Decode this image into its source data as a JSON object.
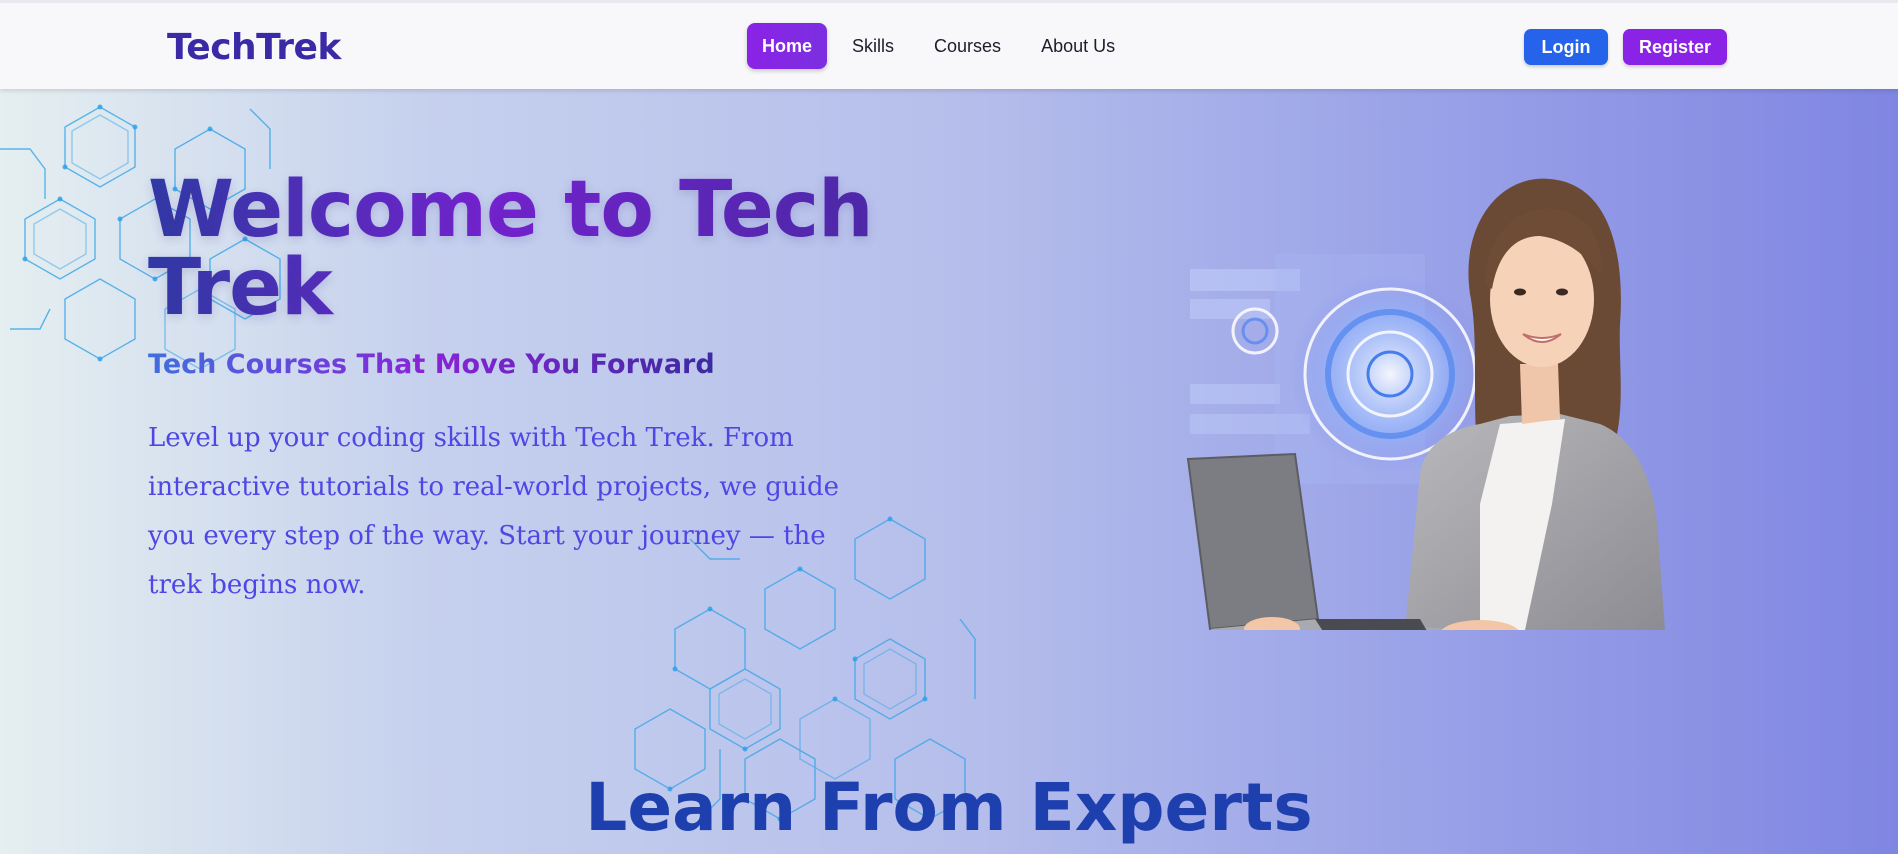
{
  "nav": {
    "logo": "TechTrek",
    "links": [
      {
        "label": "Home",
        "active": true
      },
      {
        "label": "Skills",
        "active": false
      },
      {
        "label": "Courses",
        "active": false
      },
      {
        "label": "About Us",
        "active": false
      }
    ],
    "login_label": "Login",
    "register_label": "Register"
  },
  "hero": {
    "title": "Welcome to Tech Trek",
    "subtitle": "Tech Courses That Move You Forward",
    "description": "Level up your coding skills with Tech Trek. From interactive tutorials to real-world projects, we guide you every step of the way. Start your journey — the trek begins now.",
    "image_icon": "woman-with-laptop-illustration"
  },
  "section": {
    "title": "Learn From Experts"
  },
  "colors": {
    "primary_purple": "#8a23e6",
    "login_blue": "#2563eb",
    "logo": "#3b2aa6",
    "heading_blue": "#1e40af",
    "body_text": "#4f46e5"
  }
}
